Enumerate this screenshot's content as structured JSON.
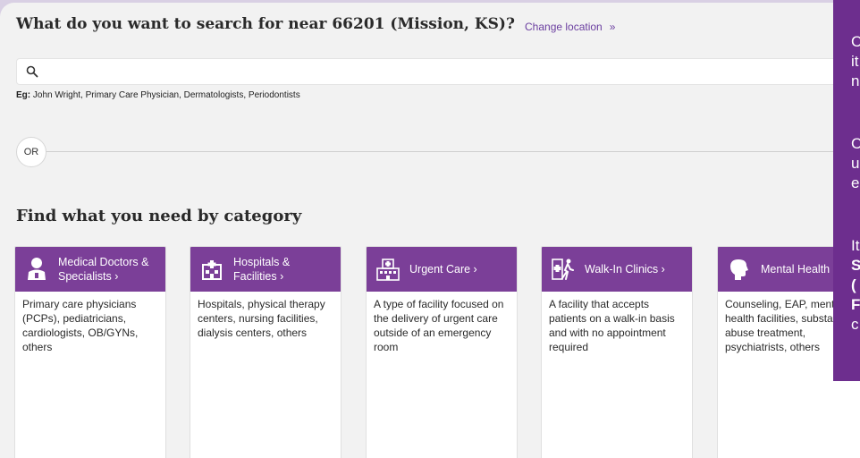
{
  "header": {
    "question": "What do you want to search for near 66201 (Mission, KS)?",
    "change_location": "Change location",
    "change_arrows": "»"
  },
  "search": {
    "placeholder": "",
    "value": "",
    "example_label": "Eg:",
    "example_text": "John Wright, Primary Care Physician, Dermatologists, Periodontists"
  },
  "divider": {
    "or": "OR"
  },
  "category_section": {
    "title": "Find what you need by category",
    "cards": [
      {
        "icon": "doctor-icon",
        "title": "Medical Doctors & Specialists ›",
        "desc": "Primary care physicians (PCPs), pediatricians, cardiologists, OB/GYNs, others"
      },
      {
        "icon": "hospital-icon",
        "title": "Hospitals & Facilities ›",
        "desc": "Hospitals, physical therapy centers, nursing facilities, dialysis centers, others"
      },
      {
        "icon": "urgent-care-building-icon",
        "title": "Urgent Care ›",
        "desc": "A type of facility focused on the delivery of urgent care outside of an emergency room"
      },
      {
        "icon": "walk-in-clinic-icon",
        "title": "Walk-In Clinics ›",
        "desc": "A facility that accepts patients on a walk-in basis and with no appointment required"
      },
      {
        "icon": "mental-health-head-icon",
        "title": "Mental Health",
        "desc": "Counseling, EAP, mental health facilities, substance abuse treatment, psychiatrists, others"
      }
    ]
  },
  "side_panel": {
    "fragments": [
      "C",
      "it",
      "n",
      "C",
      "u",
      "e",
      "It",
      "S",
      "(",
      "F",
      "c"
    ]
  },
  "colors": {
    "brand_purple": "#7b3f98",
    "side_purple": "#6d2e8e",
    "link": "#6b3fa0"
  }
}
